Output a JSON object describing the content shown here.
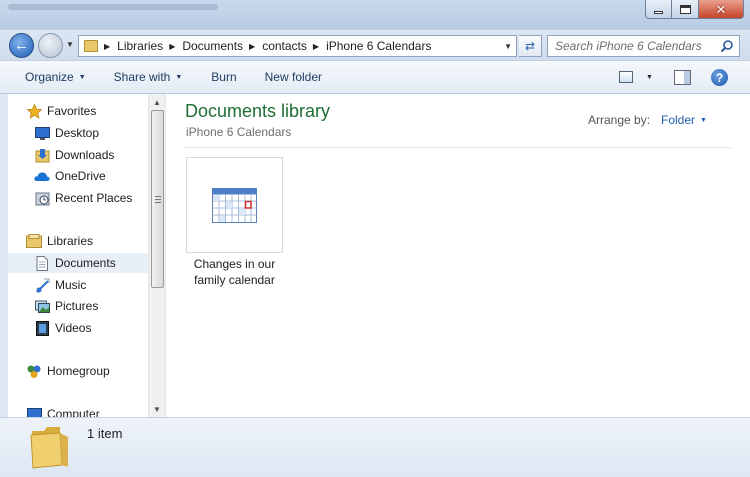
{
  "window": {
    "controls": {
      "minimize": "minimize",
      "maximize": "maximize",
      "close": "close"
    }
  },
  "navigation": {
    "back_icon": "back-arrow-icon",
    "forward_icon": "forward-arrow-icon",
    "breadcrumb": [
      "Libraries",
      "Documents",
      "contacts",
      "iPhone 6 Calendars"
    ],
    "search_placeholder": "Search iPhone 6 Calendars"
  },
  "toolbar": {
    "organize": "Organize",
    "share_with": "Share with",
    "burn": "Burn",
    "new_folder": "New folder"
  },
  "sidebar": {
    "favorites_label": "Favorites",
    "favorites": [
      {
        "label": "Desktop",
        "icon": "desktop-icon"
      },
      {
        "label": "Downloads",
        "icon": "downloads-icon"
      },
      {
        "label": "OneDrive",
        "icon": "onedrive-icon"
      },
      {
        "label": "Recent Places",
        "icon": "recent-places-icon"
      }
    ],
    "libraries_label": "Libraries",
    "libraries": [
      {
        "label": "Documents",
        "icon": "documents-icon",
        "selected": true
      },
      {
        "label": "Music",
        "icon": "music-icon"
      },
      {
        "label": "Pictures",
        "icon": "pictures-icon"
      },
      {
        "label": "Videos",
        "icon": "videos-icon"
      }
    ],
    "homegroup_label": "Homegroup",
    "computer_label": "Computer"
  },
  "content": {
    "title": "Documents library",
    "subtitle": "iPhone 6 Calendars",
    "arrange_by_label": "Arrange by:",
    "arrange_by_value": "Folder",
    "files": [
      {
        "name": "Changes in our family calendar",
        "icon": "calendar-file-icon"
      }
    ]
  },
  "details": {
    "count": "1 item"
  },
  "colors": {
    "library_title": "#1e6e36",
    "link_blue": "#1e5db0",
    "selection": "#e8eff8"
  }
}
